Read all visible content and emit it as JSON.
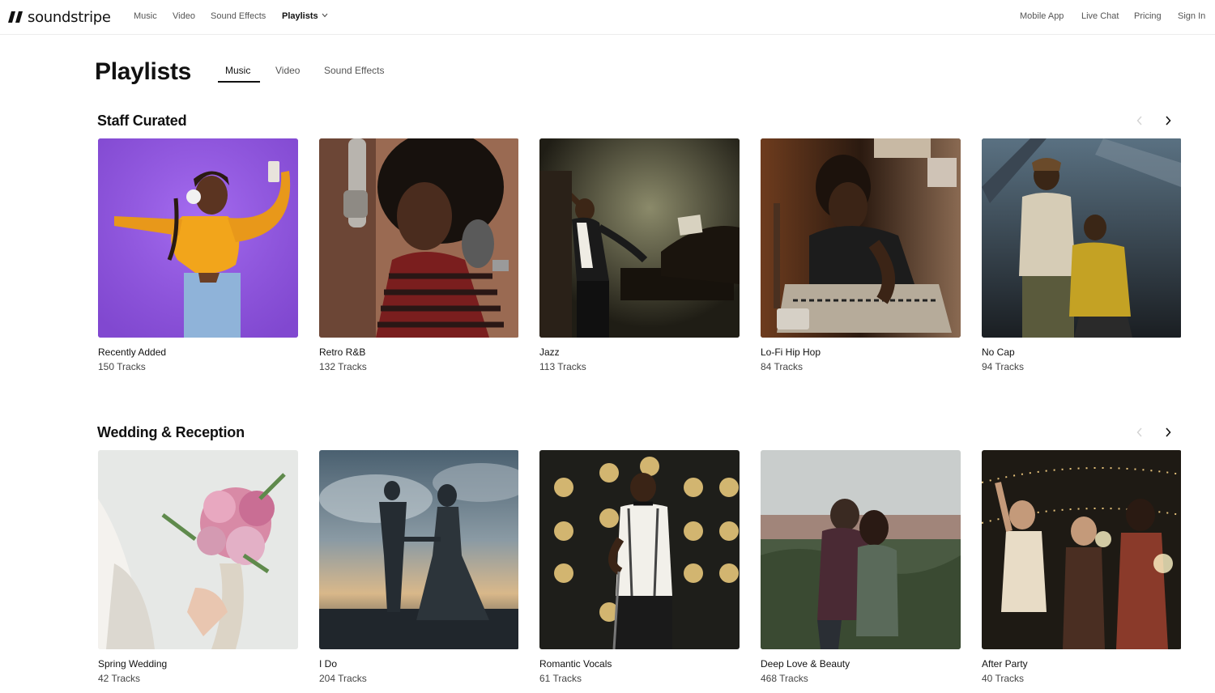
{
  "brand": {
    "name": "soundstripe"
  },
  "nav": {
    "music": "Music",
    "video": "Video",
    "sound_effects": "Sound Effects",
    "playlists": "Playlists",
    "mobile_app": "Mobile App",
    "live_chat": "Live Chat",
    "pricing": "Pricing",
    "sign_in": "Sign In"
  },
  "page": {
    "title": "Playlists",
    "tabs": [
      "Music",
      "Video",
      "Sound Effects"
    ],
    "active_tab": "Music"
  },
  "sections": [
    {
      "title": "Staff Curated",
      "cards": [
        {
          "title": "Recently Added",
          "count": "150 Tracks"
        },
        {
          "title": "Retro R&B",
          "count": "132 Tracks"
        },
        {
          "title": "Jazz",
          "count": "113 Tracks"
        },
        {
          "title": "Lo-Fi Hip Hop",
          "count": "84 Tracks"
        },
        {
          "title": "No Cap",
          "count": "94 Tracks"
        }
      ]
    },
    {
      "title": "Wedding & Reception",
      "cards": [
        {
          "title": "Spring Wedding",
          "count": "42 Tracks"
        },
        {
          "title": "I Do",
          "count": "204 Tracks"
        },
        {
          "title": "Romantic Vocals",
          "count": "61 Tracks"
        },
        {
          "title": "Deep Love & Beauty",
          "count": "468 Tracks"
        },
        {
          "title": "After Party",
          "count": "40 Tracks"
        }
      ]
    }
  ],
  "icons": {
    "logo": "soundstripe-logo-icon",
    "dropdown": "chevron-down-icon",
    "prev": "chevron-left-icon",
    "next": "chevron-right-icon"
  }
}
